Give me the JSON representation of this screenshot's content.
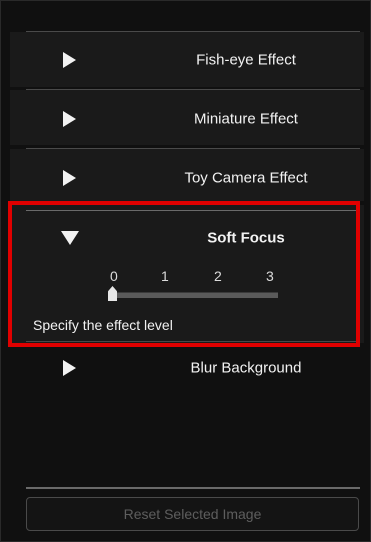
{
  "effects": [
    {
      "label": "Fish-eye Effect",
      "expanded": false
    },
    {
      "label": "Miniature Effect",
      "expanded": false
    },
    {
      "label": "Toy Camera Effect",
      "expanded": false
    },
    {
      "label": "Soft Focus",
      "expanded": true
    },
    {
      "label": "Blur Background",
      "expanded": false
    }
  ],
  "soft_focus": {
    "ticks": [
      "0",
      "1",
      "2",
      "3"
    ],
    "current_level": 0,
    "hint": "Specify the effect level"
  },
  "reset_button": {
    "label": "Reset Selected Image",
    "enabled": false
  },
  "colors": {
    "highlight": "#e00000",
    "panel_bg": "#101010",
    "text": "#f2f2f2"
  }
}
